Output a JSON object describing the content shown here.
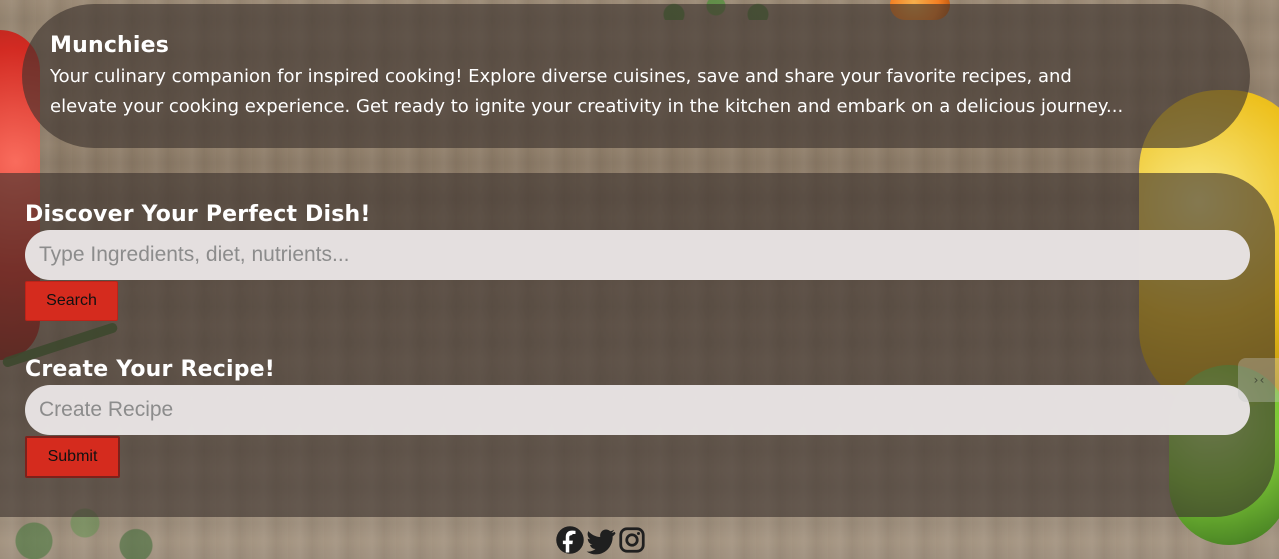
{
  "header": {
    "title": "Munchies",
    "description_line1": "Your culinary companion for inspired cooking! Explore diverse cuisines, save and share your favorite recipes, and",
    "description_line2": "elevate your cooking experience. Get ready to ignite your creativity in the kitchen and embark on a delicious journey..."
  },
  "search": {
    "heading": "Discover Your Perfect Dish!",
    "placeholder": "Type Ingredients, diet, nutrients...",
    "value": "",
    "button_label": "Search"
  },
  "create": {
    "heading": "Create Your Recipe!",
    "placeholder": "Create Recipe",
    "value": "",
    "button_label": "Submit"
  },
  "social": {
    "icons": [
      "facebook-icon",
      "twitter-icon",
      "instagram-icon"
    ]
  },
  "side_handle": {
    "label": "›‹"
  },
  "colors": {
    "button_red": "#d52b1e",
    "panel_overlay": "rgba(60, 50, 45, 0.62)",
    "input_bg": "#e7e2e2",
    "text_white": "#ffffff"
  }
}
